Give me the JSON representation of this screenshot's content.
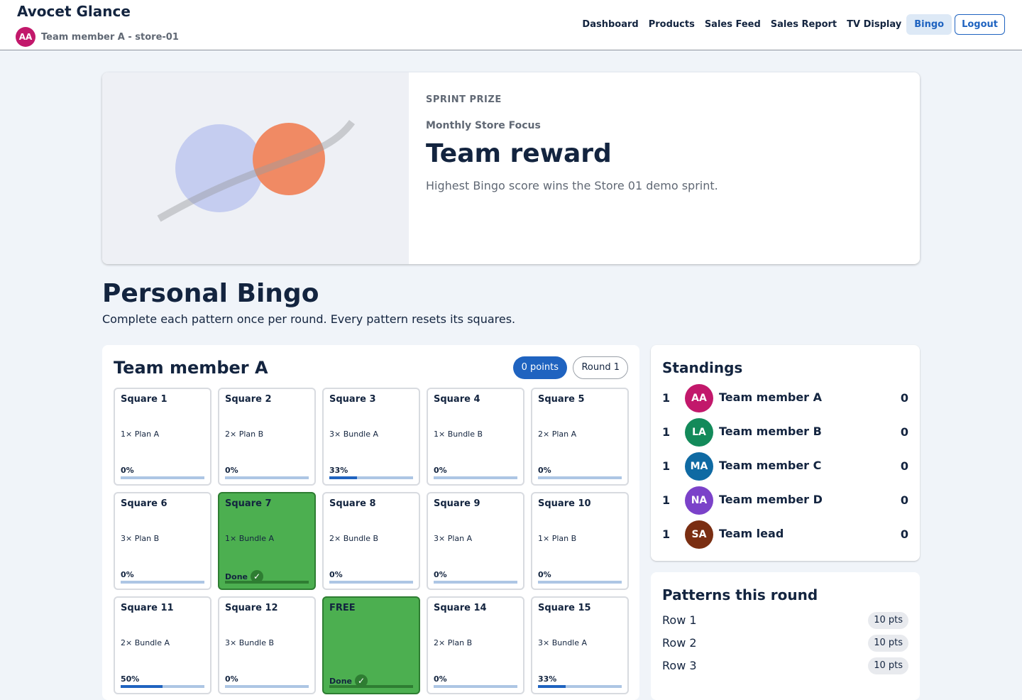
{
  "app": {
    "brand": "Avocet Glance",
    "user_initials": "AA",
    "user_line": "Team member A - store-01"
  },
  "nav": {
    "items": [
      "Dashboard",
      "Products",
      "Sales Feed",
      "Sales Report",
      "TV Display",
      "Bingo"
    ],
    "active": "Bingo",
    "logout": "Logout"
  },
  "hero": {
    "eyebrow": "SPRINT PRIZE",
    "subtitle": "Monthly Store Focus",
    "title": "Team reward",
    "description": "Highest Bingo score wins the Store 01 demo sprint."
  },
  "page": {
    "title": "Personal Bingo",
    "description": "Complete each pattern once per round. Every pattern resets its squares."
  },
  "board": {
    "player": "Team member A",
    "points": "0 points",
    "round": "Round 1",
    "squares": [
      {
        "title": "Square 1",
        "task": "1× Plan A",
        "progress": "0%",
        "done": false,
        "fill": 0
      },
      {
        "title": "Square 2",
        "task": "2× Plan B",
        "progress": "0%",
        "done": false,
        "fill": 0
      },
      {
        "title": "Square 3",
        "task": "3× Bundle A",
        "progress": "33%",
        "done": false,
        "fill": 0.33
      },
      {
        "title": "Square 4",
        "task": "1× Bundle B",
        "progress": "0%",
        "done": false,
        "fill": 0
      },
      {
        "title": "Square 5",
        "task": "2× Plan A",
        "progress": "0%",
        "done": false,
        "fill": 0
      },
      {
        "title": "Square 6",
        "task": "3× Plan B",
        "progress": "0%",
        "done": false,
        "fill": 0
      },
      {
        "title": "Square 7",
        "task": "1× Bundle A",
        "progress": "Done",
        "done": true,
        "fill": 1
      },
      {
        "title": "Square 8",
        "task": "2× Bundle B",
        "progress": "0%",
        "done": false,
        "fill": 0
      },
      {
        "title": "Square 9",
        "task": "3× Plan A",
        "progress": "0%",
        "done": false,
        "fill": 0
      },
      {
        "title": "Square 10",
        "task": "1× Plan B",
        "progress": "0%",
        "done": false,
        "fill": 0
      },
      {
        "title": "Square 11",
        "task": "2× Bundle A",
        "progress": "50%",
        "done": false,
        "fill": 0.5
      },
      {
        "title": "Square 12",
        "task": "3× Bundle B",
        "progress": "0%",
        "done": false,
        "fill": 0
      },
      {
        "title": "FREE",
        "task": "",
        "progress": "Done",
        "done": true,
        "fill": 1
      },
      {
        "title": "Square 14",
        "task": "2× Plan B",
        "progress": "0%",
        "done": false,
        "fill": 0
      },
      {
        "title": "Square 15",
        "task": "3× Bundle A",
        "progress": "33%",
        "done": false,
        "fill": 0.33
      }
    ]
  },
  "standings": {
    "title": "Standings",
    "rows": [
      {
        "rank": "1",
        "initials": "AA",
        "name": "Team member A",
        "score": "0",
        "color": "#c2186b"
      },
      {
        "rank": "1",
        "initials": "LA",
        "name": "Team member B",
        "score": "0",
        "color": "#138a5a"
      },
      {
        "rank": "1",
        "initials": "MA",
        "name": "Team member C",
        "score": "0",
        "color": "#0f6aa3"
      },
      {
        "rank": "1",
        "initials": "NA",
        "name": "Team member D",
        "score": "0",
        "color": "#7b42c9"
      },
      {
        "rank": "1",
        "initials": "SA",
        "name": "Team lead",
        "score": "0",
        "color": "#7a2e12"
      }
    ]
  },
  "patterns": {
    "title": "Patterns this round",
    "rows": [
      {
        "name": "Row 1",
        "points": "10 pts"
      },
      {
        "name": "Row 2",
        "points": "10 pts"
      },
      {
        "name": "Row 3",
        "points": "10 pts"
      }
    ]
  },
  "colors": {
    "accent": "#1f63c0",
    "done_green": "#4caf50",
    "navy": "#13243f"
  }
}
